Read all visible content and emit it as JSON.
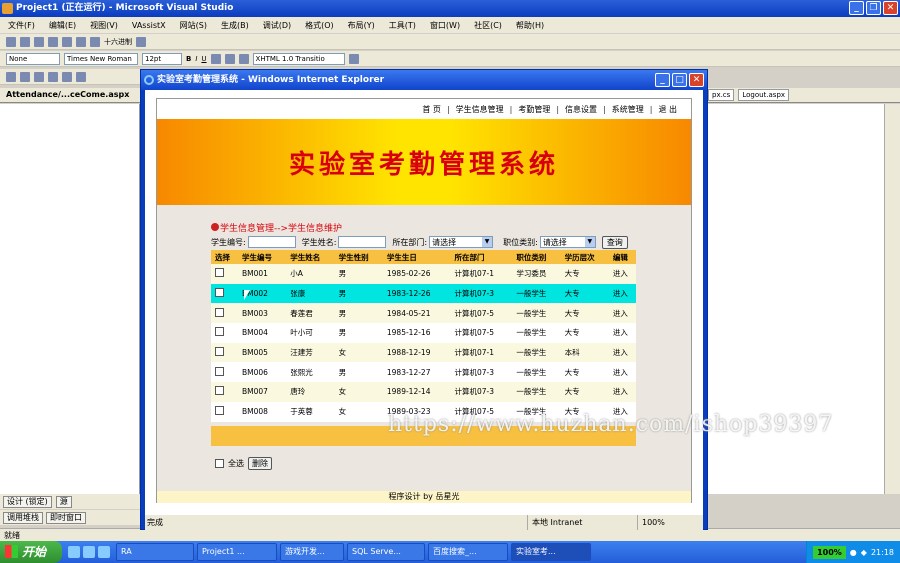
{
  "vs": {
    "title": "Project1 (正在运行) - Microsoft Visual Studio",
    "menu": [
      "文件(F)",
      "编辑(E)",
      "视图(V)",
      "VAssistX",
      "网站(S)",
      "生成(B)",
      "调试(D)",
      "格式(O)",
      "布局(Y)",
      "工具(T)",
      "窗口(W)",
      "社区(C)",
      "帮助(H)"
    ],
    "toolbar_hex": "十六进制",
    "format": {
      "block": "None",
      "font": "Times New Roman",
      "size": "12pt",
      "doctype": "XHTML 1.0 Transitio"
    },
    "doc_tab": "Attendance/...ceCome.aspx",
    "right_tabs": [
      "px.cs",
      "Logout.aspx"
    ],
    "design_tabs": [
      "设计 (锁定)",
      "源"
    ],
    "bottom_tabs": [
      "调用堆栈",
      "即时窗口"
    ],
    "status": "就绪"
  },
  "ie": {
    "title": "实验室考勤管理系统 - Windows Internet Explorer",
    "status_left": "完成",
    "zone": "本地 Intranet",
    "zoom": "100%"
  },
  "page": {
    "nav": [
      "首 页",
      "学生信息管理",
      "考勤管理",
      "信息设置",
      "系统管理",
      "退 出"
    ],
    "banner": "实验室考勤管理系统",
    "breadcrumb": "学生信息管理-->学生信息维护",
    "search": {
      "id_label": "学生编号:",
      "name_label": "学生姓名:",
      "dept_label": "所在部门:",
      "dept_value": "请选择",
      "pos_label": "职位类别:",
      "pos_value": "请选择",
      "query": "查询"
    },
    "columns": [
      "选择",
      "学生编号",
      "学生姓名",
      "学生性别",
      "学生生日",
      "所在部门",
      "职位类别",
      "学历层次",
      "编辑"
    ],
    "rows": [
      {
        "id": "BM001",
        "name": "小A",
        "sex": "男",
        "birth": "1985-02-26",
        "dept": "计算机07-1",
        "pos": "学习委员",
        "edu": "大专",
        "edit": "进入"
      },
      {
        "id": "BM002",
        "name": "张康",
        "sex": "男",
        "birth": "1983-12-26",
        "dept": "计算机07-3",
        "pos": "一般学生",
        "edu": "大专",
        "edit": "进入"
      },
      {
        "id": "BM003",
        "name": "春莲君",
        "sex": "男",
        "birth": "1984-05-21",
        "dept": "计算机07-5",
        "pos": "一般学生",
        "edu": "大专",
        "edit": "进入"
      },
      {
        "id": "BM004",
        "name": "叶小可",
        "sex": "男",
        "birth": "1985-12-16",
        "dept": "计算机07-5",
        "pos": "一般学生",
        "edu": "大专",
        "edit": "进入"
      },
      {
        "id": "BM005",
        "name": "汪建芳",
        "sex": "女",
        "birth": "1988-12-19",
        "dept": "计算机07-1",
        "pos": "一般学生",
        "edu": "本科",
        "edit": "进入"
      },
      {
        "id": "BM006",
        "name": "张熙光",
        "sex": "男",
        "birth": "1983-12-27",
        "dept": "计算机07-3",
        "pos": "一般学生",
        "edu": "大专",
        "edit": "进入"
      },
      {
        "id": "BM007",
        "name": "唐玲",
        "sex": "女",
        "birth": "1989-12-14",
        "dept": "计算机07-3",
        "pos": "一般学生",
        "edu": "大专",
        "edit": "进入"
      },
      {
        "id": "BM008",
        "name": "于英蓉",
        "sex": "女",
        "birth": "1989-03-23",
        "dept": "计算机07-5",
        "pos": "一般学生",
        "edu": "大专",
        "edit": "进入"
      }
    ],
    "select_all": "全选",
    "delete": "删除",
    "footer": "程序设计 by 岳星光"
  },
  "watermark": "https://www.huzhan.com/ishop39397",
  "taskbar": {
    "start": "开始",
    "tasks": [
      "RA",
      "Project1 ...",
      "游戏开发...",
      "SQL Serve...",
      "百度搜索_...",
      "实验室考..."
    ],
    "battery": "100%",
    "clock": "21:18"
  }
}
